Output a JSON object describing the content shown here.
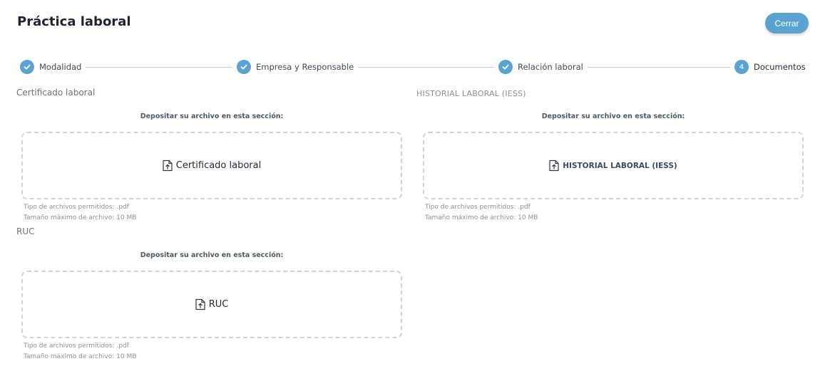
{
  "header": {
    "title": "Práctica laboral",
    "close_label": "Cerrar"
  },
  "stepper": {
    "steps": [
      {
        "label": "Modalidad",
        "status": "completed",
        "icon": "check-icon"
      },
      {
        "label": "Empresa y Responsable",
        "status": "completed",
        "icon": "check-icon"
      },
      {
        "label": "Relación laboral",
        "status": "completed",
        "icon": "check-icon"
      },
      {
        "label": "Documentos",
        "status": "active",
        "number": "4"
      }
    ]
  },
  "uploads": [
    {
      "section_label": "Certificado laboral",
      "deposit_text": "Depositar su archivo en esta sección:",
      "dropzone_label": "Certificado laboral",
      "allowed_types": "Tipo de archivos permitidos: .pdf",
      "max_size": "Tamaño máximo de archivo: 10 MB"
    },
    {
      "section_label": "HISTORIAL LABORAL (IESS)",
      "deposit_text": "Depositar su archivo en esta sección:",
      "dropzone_label": "HISTORIAL LABORAL (IESS)",
      "allowed_types": "Tipo de archivos permitidos: .pdf",
      "max_size": "Tamaño máximo de archivo: 10 MB"
    },
    {
      "section_label": "RUC",
      "deposit_text": "Depositar su archivo en esta sección:",
      "dropzone_label": "RUC",
      "allowed_types": "Tipo de archivos permitidos: .pdf",
      "max_size": "Tamaño máximo de archivo: 10 MB"
    }
  ],
  "colors": {
    "accent": "#5aa3d1",
    "dropzone_border": "#cfd3da"
  }
}
